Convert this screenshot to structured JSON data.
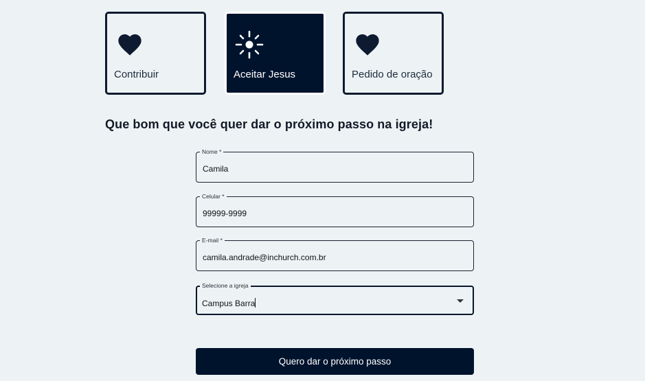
{
  "options": [
    {
      "label": "Contribuir",
      "icon": "heart-icon",
      "selected": false
    },
    {
      "label": "Aceitar Jesus",
      "icon": "sun-icon",
      "selected": true
    },
    {
      "label": "Pedido de oração",
      "icon": "heart-icon",
      "selected": false
    }
  ],
  "heading": "Que bom que você quer dar o próximo passo na igreja!",
  "form": {
    "name": {
      "label": "Nome *",
      "value": "Camila"
    },
    "phone": {
      "label": "Celular *",
      "value": "99999-9999"
    },
    "email": {
      "label": "E-mail *",
      "value": "camila.andrade@inchurch.com.br"
    },
    "church": {
      "label": "Selecione a igreja",
      "value": "Campus Barra"
    }
  },
  "submit_label": "Quero dar o próximo passo",
  "colors": {
    "background": "#edf3f5",
    "primary": "#00132d",
    "selected_card": "#00132d"
  }
}
